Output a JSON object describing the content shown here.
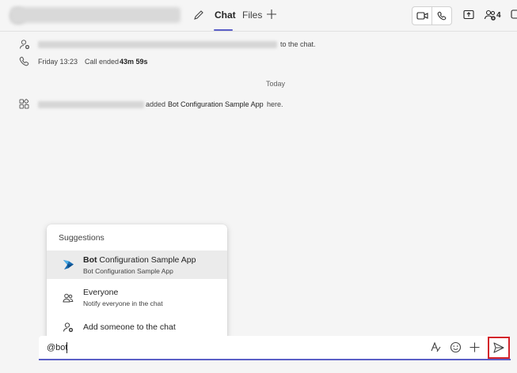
{
  "header": {
    "tabs": [
      {
        "label": "Chat",
        "active": true
      },
      {
        "label": "Files",
        "active": false
      }
    ],
    "participant_count": "4"
  },
  "feed": {
    "added_suffix": "to the chat.",
    "call": {
      "day": "Friday 13:23",
      "text": "Call ended",
      "duration": "43m 59s"
    },
    "divider": "Today",
    "app_added": {
      "verb": "added",
      "app_name": "Bot Configuration Sample App",
      "suffix": "here."
    }
  },
  "suggestions": {
    "title": "Suggestions",
    "items": [
      {
        "bold": "Bot",
        "rest": " Configuration Sample App",
        "subtitle": "Bot Configuration Sample App",
        "icon": "bot-app-icon",
        "selected": true
      },
      {
        "label": "Everyone",
        "subtitle": "Notify everyone in the chat",
        "icon": "people-icon"
      },
      {
        "label": "Add someone to the chat",
        "icon": "person-add-icon"
      }
    ]
  },
  "compose": {
    "value": "@bot"
  },
  "colors": {
    "accent": "#5b5fc7",
    "send_highlight": "#d3222a"
  }
}
